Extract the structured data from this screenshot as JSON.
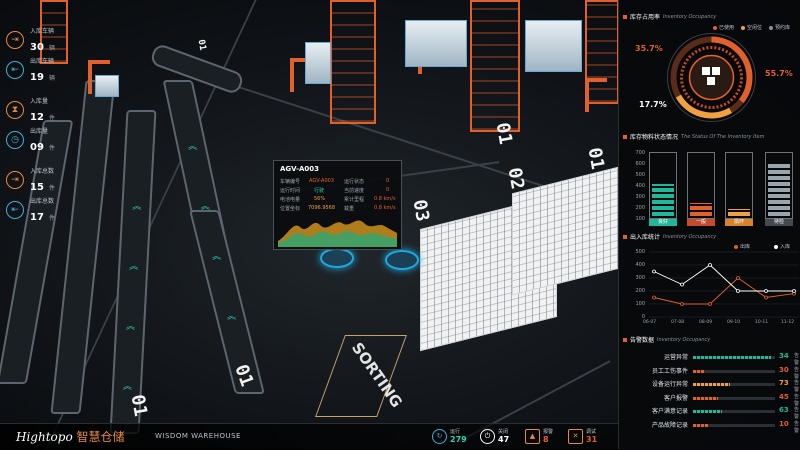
{
  "left_stats": [
    {
      "label": "入库车辆",
      "value": "30",
      "unit": "辆",
      "icon": "truck-in-icon"
    },
    {
      "label": "出库车辆",
      "value": "19",
      "unit": "辆",
      "icon": "truck-out-icon"
    },
    {
      "label": "入库量",
      "value": "12",
      "unit": "件",
      "icon": "hourglass-icon"
    },
    {
      "label": "出库量",
      "value": "09",
      "unit": "件",
      "icon": "clock-icon"
    },
    {
      "label": "入库总数",
      "value": "15",
      "unit": "件",
      "icon": "truck-in-icon"
    },
    {
      "label": "出库总数",
      "value": "17",
      "unit": "件",
      "icon": "truck-out-icon"
    }
  ],
  "popup": {
    "title": "AGV-A003",
    "rows": [
      {
        "label": "车辆编号",
        "value": "AGV-A003",
        "label2": "运行状态",
        "value2": "0"
      },
      {
        "label": "运行时间",
        "value": "行驶",
        "label2": "当前速度",
        "value2": "0"
      },
      {
        "label": "电池电量",
        "value": "56%",
        "label2": "累计里程",
        "value2": "0.8 km/s"
      },
      {
        "label": "位置坐标",
        "value": "7096.9568",
        "label2": "载重",
        "value2": "0.8 km/s"
      }
    ]
  },
  "scene": {
    "zone_labels": [
      "01",
      "02",
      "03",
      "01",
      "01",
      "01",
      "01"
    ],
    "sorting_label": "SORTING"
  },
  "panel": {
    "occupancy": {
      "title": "库存占用率",
      "subtitle": "Inventory Occupancy",
      "legend": [
        "已使用",
        "空闲位",
        "预约库"
      ],
      "legend_colors": [
        "#e2602b",
        "#f0a040",
        "#8a939a"
      ],
      "pct_left": "35.7%",
      "pct_right": "55.7%",
      "pct_bottom": "17.7%"
    },
    "material": {
      "title": "库存物料状态情况",
      "subtitle": "The Status Of The Inventory Item",
      "yticks": [
        "700",
        "600",
        "500",
        "400",
        "300",
        "200",
        "100"
      ],
      "bars": [
        {
          "label": "良好",
          "level": 0.55,
          "color": "#1fb89a",
          "tag_color": "#1fb89a"
        },
        {
          "label": "一般",
          "level": 0.22,
          "color": "#e2602b",
          "tag_color": "#c84a28"
        },
        {
          "label": "损坏",
          "level": 0.12,
          "color": "#f0a040",
          "tag_color": "#d88428"
        },
        {
          "label": "待检",
          "level": 0.9,
          "color": "#9aa5ad",
          "tag_color": "#444a50"
        }
      ]
    },
    "inout": {
      "title": "出入库统计",
      "subtitle": "Inventory Occupancy",
      "legend": [
        "出库",
        "入库"
      ],
      "legend_colors": [
        "#e2602b",
        "#ffffff"
      ],
      "yticks": [
        "500",
        "400",
        "300",
        "200",
        "100",
        "0"
      ],
      "xticks": [
        "06-07",
        "07-08",
        "08-09",
        "09-10",
        "10-11",
        "11-12"
      ]
    },
    "alerts": {
      "title": "告警数据",
      "subtitle": "Inventory Occupancy",
      "rows": [
        {
          "name": "运营异常",
          "value": "34",
          "unit": "告警",
          "level": 0.95,
          "color": "#1fb89a"
        },
        {
          "name": "员工工伤事件",
          "value": "30",
          "unit": "告警",
          "level": 0.15,
          "color": "#e2602b"
        },
        {
          "name": "设备运行异常",
          "value": "73",
          "unit": "告警",
          "level": 0.45,
          "color": "#f0a040"
        },
        {
          "name": "客户报警",
          "value": "45",
          "unit": "告警",
          "level": 0.3,
          "color": "#e2602b"
        },
        {
          "name": "客户满意记录",
          "value": "63",
          "unit": "告警",
          "level": 0.35,
          "color": "#1fb89a"
        },
        {
          "name": "产品故障记录",
          "value": "10",
          "unit": "告警",
          "level": 0.18,
          "color": "#e2602b"
        }
      ]
    }
  },
  "footer": {
    "brand": "Hightopo",
    "brand_cn": "智慧仓储",
    "brand_en": "WISDOM WAREHOUSE",
    "stats": [
      {
        "label": "运行",
        "value": "279",
        "color": "#2fd1b6",
        "icon": "refresh-icon"
      },
      {
        "label": "关闭",
        "value": "47",
        "color": "#ffffff",
        "icon": "power-icon"
      },
      {
        "label": "报警",
        "value": "8",
        "color": "#e2602b",
        "icon": "warning-icon"
      },
      {
        "label": "调试",
        "value": "31",
        "color": "#e2602b",
        "icon": "tools-icon"
      }
    ]
  },
  "chart_data": [
    {
      "type": "pie",
      "title": "库存占用率",
      "categories": [
        "已使用",
        "空闲位",
        "预约库"
      ],
      "values": [
        35.7,
        55.7,
        17.7
      ]
    },
    {
      "type": "bar",
      "title": "库存物料状态情况",
      "categories": [
        "良好",
        "一般",
        "损坏",
        "待检"
      ],
      "values": [
        380,
        150,
        80,
        630
      ],
      "ylim": [
        0,
        700
      ]
    },
    {
      "type": "line",
      "title": "出入库统计",
      "x": [
        "06-07",
        "07-08",
        "08-09",
        "09-10",
        "10-11",
        "11-12"
      ],
      "series": [
        {
          "name": "出库",
          "values": [
            150,
            100,
            100,
            300,
            150,
            180
          ]
        },
        {
          "name": "入库",
          "values": [
            350,
            250,
            400,
            200,
            200,
            200
          ]
        }
      ],
      "ylim": [
        0,
        500
      ]
    }
  ]
}
